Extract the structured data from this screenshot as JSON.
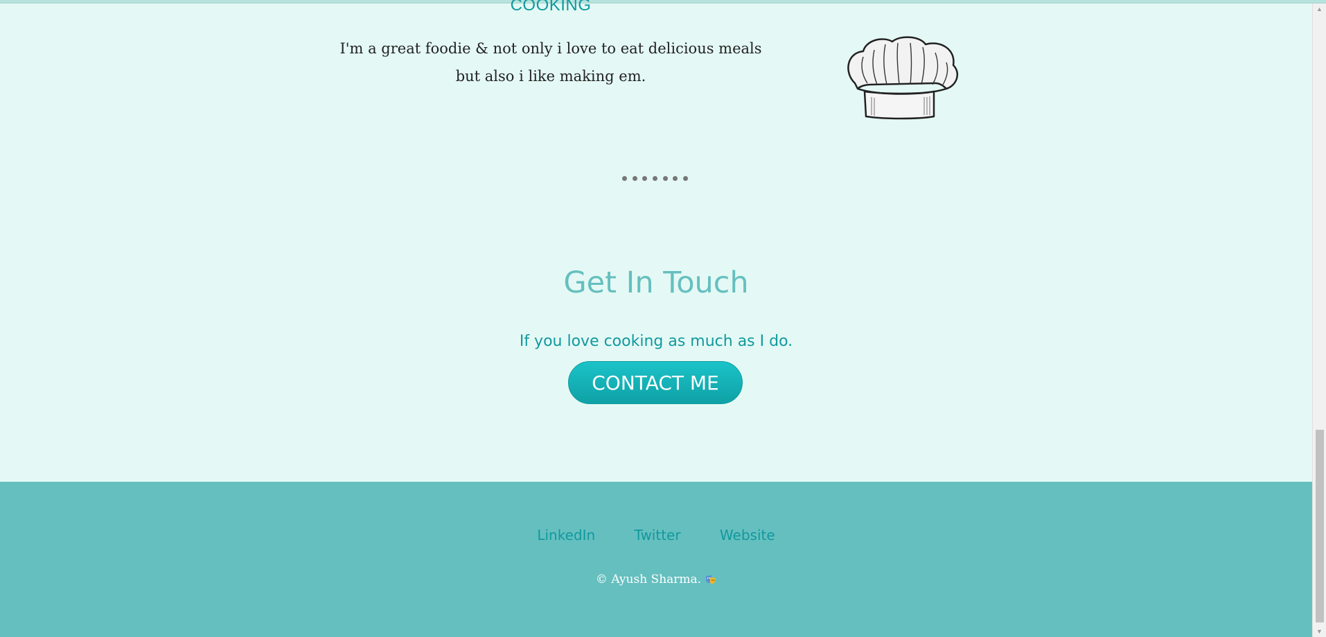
{
  "skill": {
    "title": "COOKING",
    "description": "I'm a great foodie & not only i love to eat delicious meals but also i like making em.",
    "image_icon": "chef-hat-icon"
  },
  "contact": {
    "heading": "Get In Touch",
    "subheading": "If you love cooking as much as I do.",
    "button_label": "CONTACT ME"
  },
  "footer": {
    "links": [
      "LinkedIn",
      "Twitter",
      "Website"
    ],
    "copyright": "© Ayush Sharma."
  },
  "colors": {
    "background": "#e4f9f5",
    "accent": "#11999e",
    "heading": "#66bfbf",
    "footer": "#66bfbf"
  }
}
